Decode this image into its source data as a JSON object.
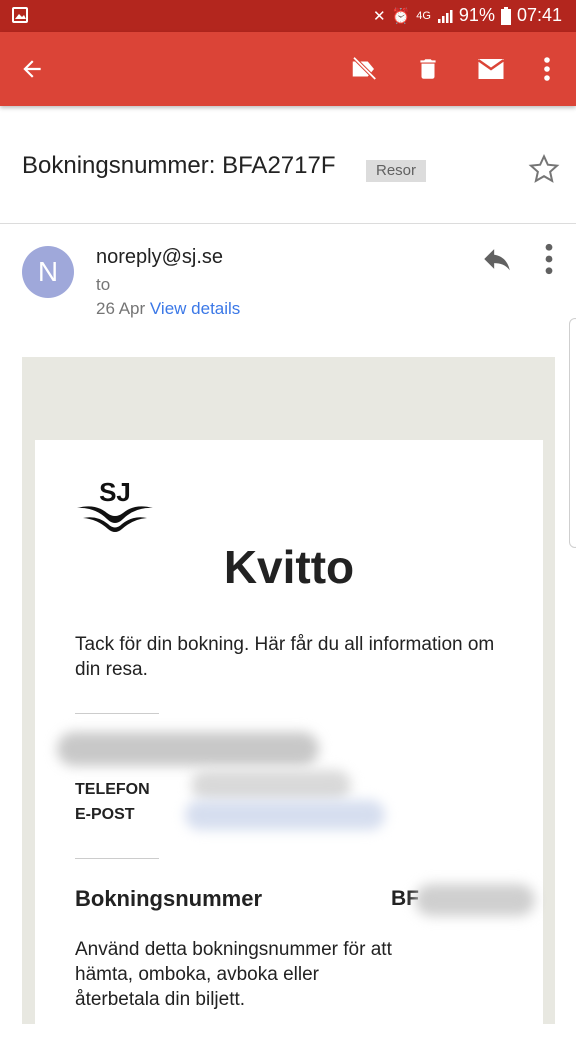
{
  "statusbar": {
    "battery": "91%",
    "time": "07:41",
    "network": "4G"
  },
  "toolbar": {
    "back_icon": "arrow-left-icon",
    "label_icon": "label-off-icon",
    "delete_icon": "trash-icon",
    "mark_unread_icon": "mail-icon",
    "more_icon": "more-vert-icon"
  },
  "subject": {
    "title": "Bokningsnummer: BFA2717F",
    "label": "Resor"
  },
  "sender": {
    "avatar_letter": "N",
    "from": "noreply@sj.se",
    "to": "to",
    "date": "26 Apr",
    "view_details": "View details"
  },
  "email": {
    "logo_text": "SJ",
    "heading": "Kvitto",
    "intro": "Tack för din bokning. Här får du all information om din resa.",
    "telefon_label": "TELEFON",
    "epost_label": "E-POST",
    "booking_title": "Bokningsnummer",
    "booking_value": "BF",
    "booking_desc": "Använd detta bokningsnummer för att hämta, omboka, avboka eller återbetala din biljett."
  }
}
